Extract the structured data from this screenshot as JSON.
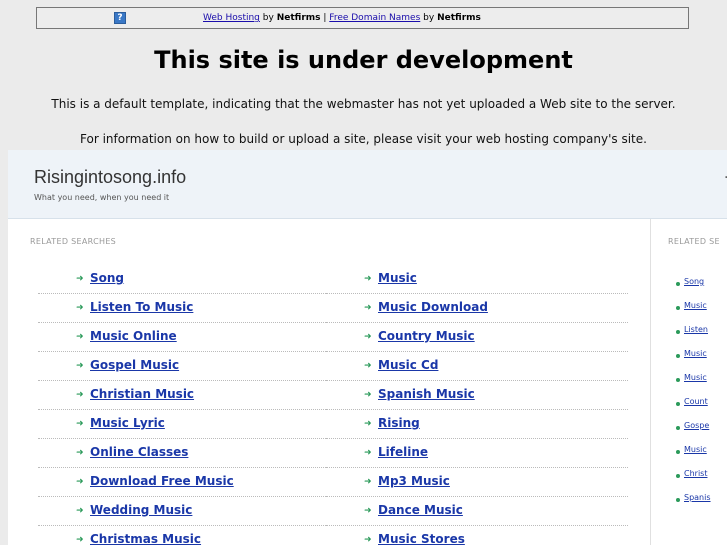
{
  "topbar": {
    "help_icon": "?",
    "link1": "Web Hosting",
    "by1": "by",
    "brand1": "Netfirms",
    "sep": "|",
    "link2": "Free Domain Names",
    "by2": "by",
    "brand2": "Netfirms"
  },
  "headline": "This site is under development",
  "sub1": "This is a default template, indicating that the webmaster has not yet uploaded a Web site to the server.",
  "sub2": "For information on how to build or upload a site, please visit your web hosting company's site.",
  "panel": {
    "domain": "Risingintosong.info",
    "tagline": "What you need, when you need it",
    "related_label_left": "RELATED SEARCHES",
    "related_label_right": "RELATED SE"
  },
  "left_links": [
    "Song",
    "Listen To Music",
    "Music Online",
    "Gospel Music",
    "Christian Music",
    "Music Lyric",
    "Online Classes",
    "Download Free Music",
    "Wedding Music",
    "Christmas Music"
  ],
  "right_links": [
    "Music",
    "Music Download",
    "Country Music",
    "Music Cd",
    "Spanish Music",
    "Rising",
    "Lifeline",
    "Mp3 Music",
    "Dance Music",
    "Music Stores"
  ],
  "side_links": [
    "Song",
    "Music",
    "Listen",
    "Music",
    "Music",
    "Count",
    "Gospe",
    "Music",
    "Christ",
    "Spanis"
  ],
  "colors": {
    "background": "#ebebeb",
    "link": "#1a37a8",
    "arrow": "#2b9a5a"
  }
}
